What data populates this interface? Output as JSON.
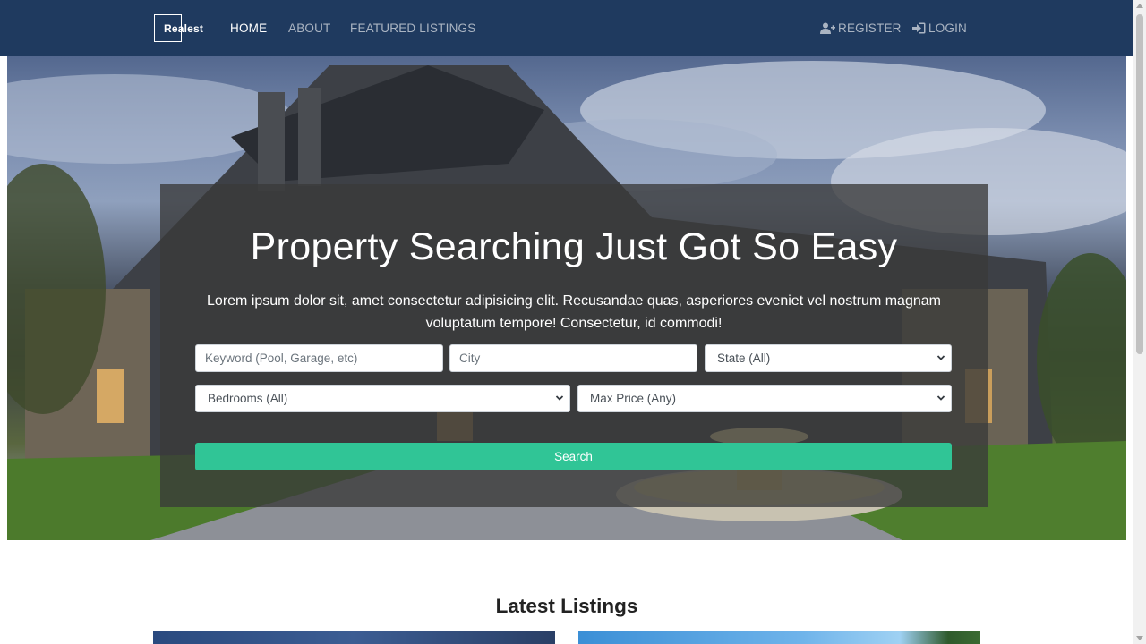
{
  "nav": {
    "brand": "Realest",
    "links": [
      "HOME",
      "ABOUT",
      "FEATURED LISTINGS"
    ],
    "register": "REGISTER",
    "login": "LOGIN"
  },
  "hero": {
    "title": "Property Searching Just Got So Easy",
    "subtitle": "Lorem ipsum dolor sit, amet consectetur adipisicing elit. Recusandae quas, asperiores eveniet vel nostrum magnam voluptatum tempore! Consectetur, id commodi!",
    "search": {
      "keyword_placeholder": "Keyword (Pool, Garage, etc)",
      "city_placeholder": "City",
      "state_selected": "State (All)",
      "bedrooms_selected": "Bedrooms (All)",
      "price_selected": "Max Price (Any)",
      "button": "Search"
    }
  },
  "latest": {
    "title": "Latest Listings"
  },
  "icons": {
    "register": "user-plus-icon",
    "login": "sign-in-icon",
    "select_chevron": "chevron-down-icon"
  },
  "colors": {
    "navbar": "#1f3a5f",
    "accent": "#30c596"
  }
}
